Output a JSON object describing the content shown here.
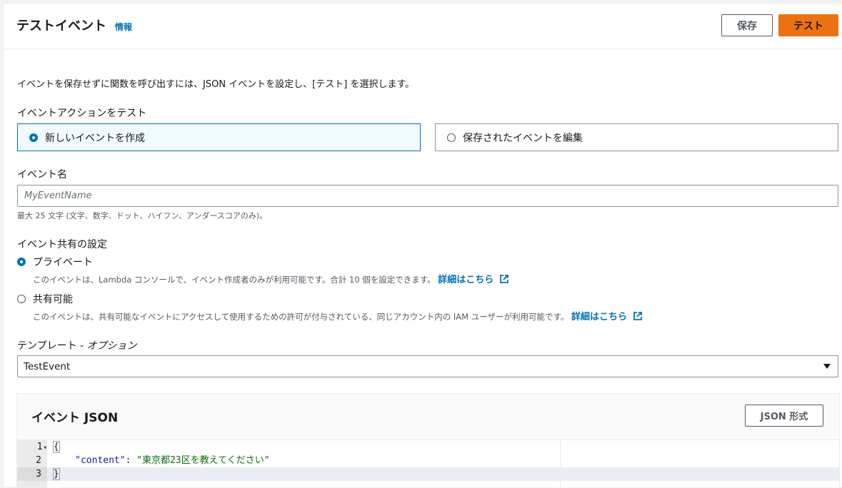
{
  "header": {
    "title": "テストイベント",
    "info_link": "情報",
    "save_label": "保存",
    "test_label": "テスト"
  },
  "description": "イベントを保存せずに関数を呼び出すには、JSON イベントを設定し、[テスト] を選択します。",
  "event_action": {
    "label": "イベントアクションをテスト",
    "options": [
      {
        "label": "新しいイベントを作成",
        "selected": true
      },
      {
        "label": "保存されたイベントを編集",
        "selected": false
      }
    ]
  },
  "event_name": {
    "label": "イベント名",
    "placeholder": "MyEventName",
    "value": "",
    "hint": "最大 25 文字 (文字、数字、ドット、ハイフン、アンダースコアのみ)。"
  },
  "sharing": {
    "label": "イベント共有の設定",
    "options": [
      {
        "label": "プライベート",
        "selected": true,
        "description": "このイベントは、Lambda コンソールで、イベント作成者のみが利用可能です。合計 10 個を設定できます。",
        "link": "詳細はこちら"
      },
      {
        "label": "共有可能",
        "selected": false,
        "description": "このイベントは、共有可能なイベントにアクセスして使用するための許可が付与されている、同じアカウント内の IAM ユーザーが利用可能です。",
        "link": "詳細はこちら"
      }
    ]
  },
  "template": {
    "label_main": "テンプレート - ",
    "label_optional": "オプション",
    "selected": "TestEvent"
  },
  "event_json": {
    "title": "イベント JSON",
    "format_button": "JSON 形式",
    "lines": [
      {
        "number": "1",
        "open_brace": "{"
      },
      {
        "number": "2",
        "key": "\"content\"",
        "colon": ": ",
        "value": "\"東京都23区を教えてください\""
      },
      {
        "number": "3",
        "close_brace": "}"
      }
    ]
  },
  "colors": {
    "accent": "#0073bb",
    "primary_button": "#ec7211",
    "selected_tile_bg": "#f1faff"
  }
}
